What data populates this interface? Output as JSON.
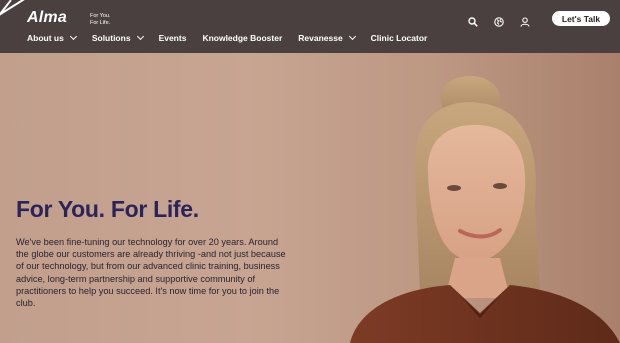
{
  "brand": {
    "name": "Alma",
    "tagline_1": "For You.",
    "tagline_2": "For Life.",
    "text_color": "#ffffff"
  },
  "nav": {
    "items": [
      {
        "label": "About us",
        "dropdown": true
      },
      {
        "label": "Solutions",
        "dropdown": true
      },
      {
        "label": "Events",
        "dropdown": false
      },
      {
        "label": "Knowledge Booster",
        "dropdown": false
      },
      {
        "label": "Revanesse",
        "dropdown": true
      },
      {
        "label": "Clinic Locator",
        "dropdown": false
      }
    ]
  },
  "tools": {
    "icons": [
      "search-icon",
      "globe-icon",
      "user-icon"
    ],
    "cta_label": "Let's Talk"
  },
  "hero": {
    "headline": "For You. For Life.",
    "body": "We've been fine-tuning our technology for over 20 years. Around the globe our customers are already thriving -and not just because of our technology, but from our advanced clinic training, business advice, long-term partnership and supportive community of practitioners to help you succeed. It's now time for you to join the club.",
    "headline_color": "#2c2459"
  },
  "colors": {
    "header_bg": "#4a403f",
    "hero_bg": "#c7a592"
  }
}
